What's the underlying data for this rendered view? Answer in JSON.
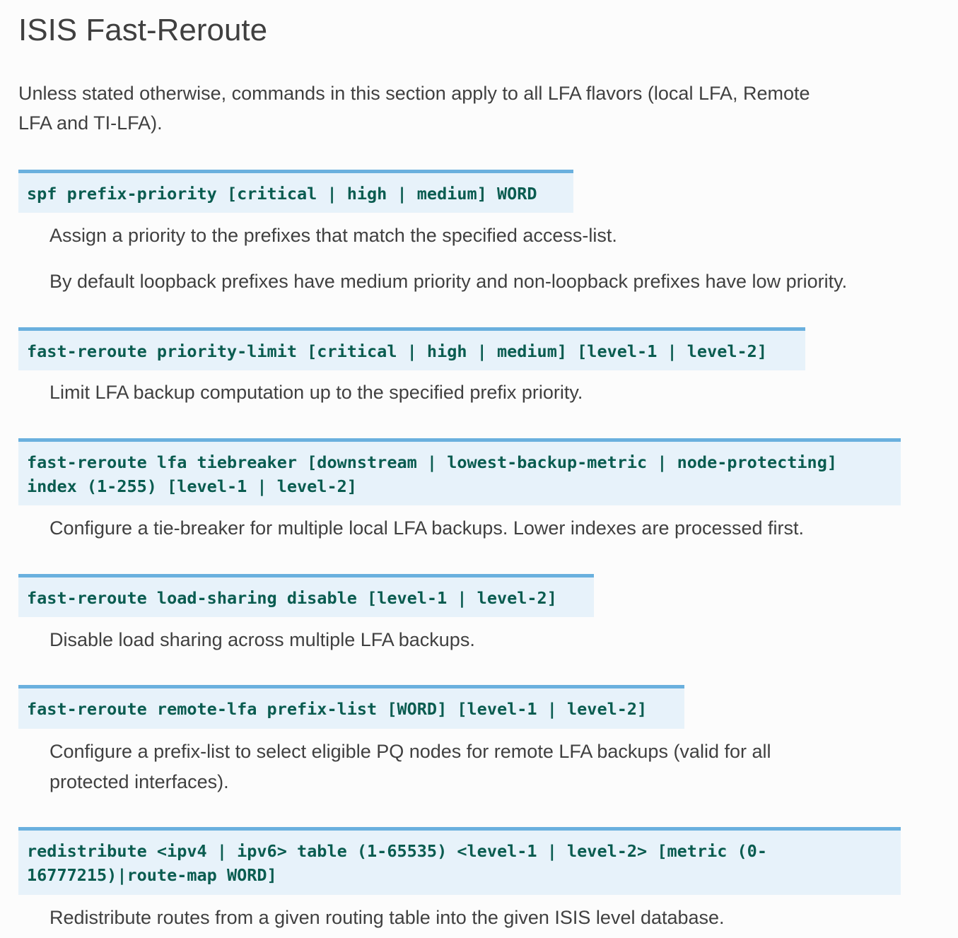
{
  "title": "ISIS Fast-Reroute",
  "intro_line1": "Unless stated otherwise, commands in this section apply to all LFA flavors (local LFA, Remote",
  "intro_line2": "LFA and TI-LFA).",
  "commands": [
    {
      "signature": "spf prefix-priority [critical | high | medium] WORD",
      "descriptions": [
        "Assign a priority to the prefixes that match the specified access-list.",
        "By default loopback prefixes have medium priority and non-loopback prefixes have low priority."
      ]
    },
    {
      "signature": "fast-reroute priority-limit [critical | high | medium] [level-1 | level-2]",
      "descriptions": [
        "Limit LFA backup computation up to the specified prefix priority."
      ]
    },
    {
      "signature_line1": "fast-reroute lfa tiebreaker [downstream | lowest-backup-metric | node-protecting]",
      "signature_line2": "index (1-255) [level-1 | level-2]",
      "descriptions": [
        "Configure a tie-breaker for multiple local LFA backups. Lower indexes are processed first."
      ]
    },
    {
      "signature": "fast-reroute load-sharing disable [level-1 | level-2]",
      "descriptions": [
        "Disable load sharing across multiple LFA backups."
      ]
    },
    {
      "signature": "fast-reroute remote-lfa prefix-list [WORD] [level-1 | level-2]",
      "description_line1": "Configure a prefix-list to select eligible PQ nodes for remote LFA backups (valid for all",
      "description_line2": "protected interfaces)."
    },
    {
      "signature_line1": "redistribute <ipv4 | ipv6> table (1-65535) <level-1 | level-2> [metric (0-",
      "signature_line2": "16777215)|route-map WORD]",
      "descriptions": [
        "Redistribute routes from a given routing table into the given ISIS level database."
      ]
    }
  ]
}
